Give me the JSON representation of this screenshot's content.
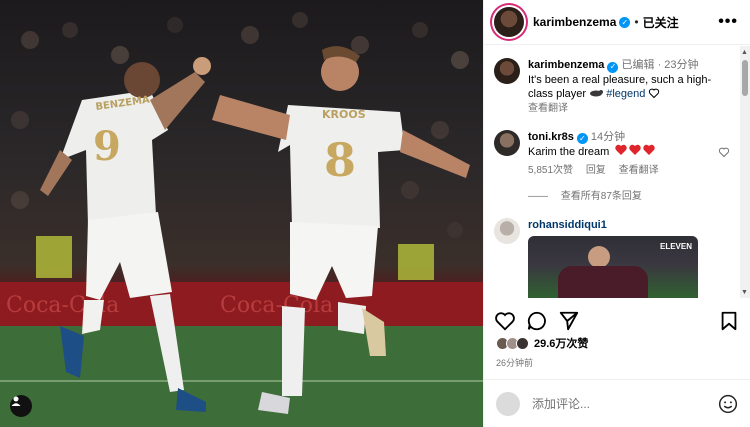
{
  "post": {
    "username": "karimbenzema",
    "follow_label": "已关注",
    "more_label": "•••"
  },
  "caption": {
    "username": "karimbenzema",
    "edited": "已编辑",
    "time": "23分钟",
    "text": "It's been a real pleasure, such a high-class player",
    "hashtag": "#legend",
    "translate": "查看翻译"
  },
  "comments": [
    {
      "username": "toni.kr8s",
      "time": "14分钟",
      "text": "Karim the dream",
      "likes": "5,851次赞",
      "reply": "回复",
      "translate": "查看翻译",
      "view_replies": "查看所有87条回复"
    },
    {
      "username": "rohansiddiqui1",
      "media_badge": "ELEVEN"
    }
  ],
  "engagement": {
    "likes": "29.6万次赞",
    "posted": "26分钟前"
  },
  "composer": {
    "placeholder": "添加评论..."
  },
  "photo": {
    "player_left_name": "BENZEMA",
    "player_left_number": "9",
    "player_right_name": "KROOS",
    "player_right_number": "8"
  },
  "colors": {
    "verified": "#0095f6",
    "heart_red": "#ed4956",
    "link": "#00376b"
  }
}
